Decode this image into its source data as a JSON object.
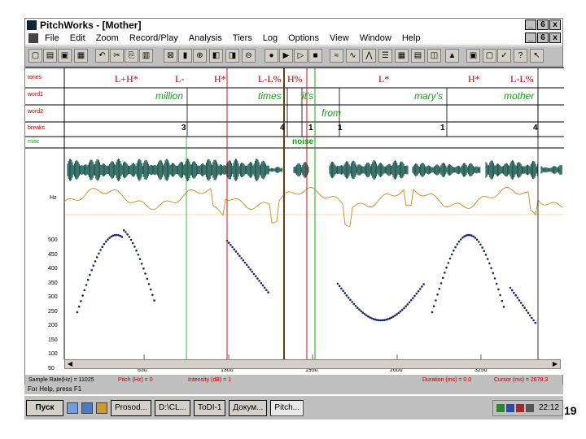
{
  "window": {
    "title": "PitchWorks - [Mother]",
    "controls": [
      "_",
      "6",
      "x"
    ],
    "doc_controls": [
      "_",
      "6",
      "x"
    ]
  },
  "menu": [
    "File",
    "Edit",
    "Zoom",
    "Record/Play",
    "Analysis",
    "Tiers",
    "Log",
    "Options",
    "View",
    "Window",
    "Help"
  ],
  "tiers": {
    "labels": [
      "tones",
      "word1",
      "word2",
      "breaks",
      "misc"
    ],
    "tones": [
      {
        "t": "L+H*",
        "at": 0.09
      },
      {
        "t": "L-",
        "at": 0.27
      },
      {
        "t": "H*",
        "at": 0.36
      },
      {
        "t": "L-L%",
        "at": 0.45
      },
      {
        "t": "H%",
        "at": 0.53
      },
      {
        "t": "L*",
        "at": 0.72
      },
      {
        "t": "H*",
        "at": 0.87
      },
      {
        "t": "L-L%",
        "at": 0.96
      }
    ],
    "word1": [
      {
        "t": "million",
        "at": 0.28
      },
      {
        "t": "times",
        "at": 0.49
      },
      {
        "t": "it's",
        "at": 0.56
      },
      {
        "t": "mary's",
        "at": 0.81
      },
      {
        "t": "mother",
        "at": 0.97
      }
    ],
    "word2": [
      {
        "t": "from",
        "at": 0.58
      }
    ],
    "breaks": [
      {
        "t": "3",
        "at": 0.31
      },
      {
        "t": "4",
        "at": 0.5
      },
      {
        "t": "1",
        "at": 0.56
      },
      {
        "t": "1",
        "at": 0.62
      },
      {
        "t": "1",
        "at": 0.8
      },
      {
        "t": "4",
        "at": 0.96
      }
    ],
    "misc": [
      {
        "t": "noise",
        "at": 0.55
      }
    ]
  },
  "pitch_axis": {
    "ticks": [
      "500",
      "450",
      "400",
      "350",
      "300",
      "250",
      "200",
      "150",
      "100",
      "50"
    ],
    "unit": "Hz",
    "time_ticks": [
      "650",
      "1300",
      "1950",
      "2600",
      "3250"
    ]
  },
  "status": {
    "sample_rate": "Sample Rate(Hz) = 11025",
    "pitch": "Pitch (Hz) = 0",
    "intensity": "Intensity (dB) = 1",
    "duration": "Duration (ms) = 0.0",
    "cursor": "Cursor (ms) = 2678.3"
  },
  "help": "For Help, press F1",
  "taskbar": {
    "start": "Пуск",
    "buttons": [
      "Prosod...",
      "D:\\CL...",
      "ToDI-1",
      "Докум...",
      "Pitch..."
    ],
    "clock": "22:12"
  },
  "page_number": "19",
  "colors": {
    "accent_red": "#b00000",
    "waveform": "#0f4f46",
    "intensity": "#c98a1a",
    "pitch": "#1a2466",
    "marker_red": "#d01010",
    "marker_green": "#19a019",
    "marker_brown": "#6b3a10"
  }
}
